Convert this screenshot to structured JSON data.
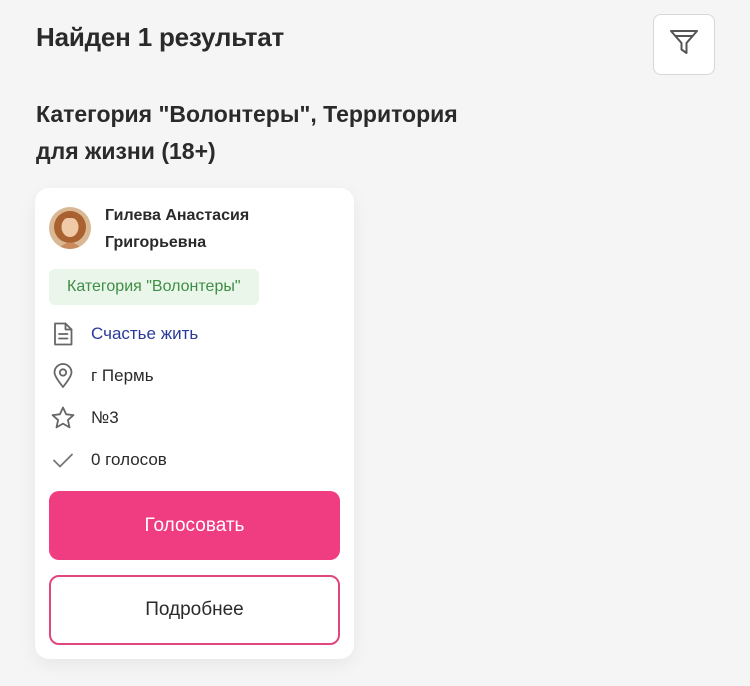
{
  "header": {
    "results_title": "Найден 1 результат",
    "filter_icon": "filter-funnel-icon"
  },
  "subtitle": "Категория \"Волонтеры\", Территория для жизни (18+)",
  "card": {
    "author_name": "Гилева Анастасия Григорьевна",
    "category_badge": "Категория \"Волонтеры\"",
    "project_link": "Счастье жить",
    "city": "г Пермь",
    "number": "№3",
    "votes": "0 голосов",
    "vote_button": "Голосовать",
    "details_button": "Подробнее",
    "icons": {
      "project": "document-icon",
      "city": "location-pin-icon",
      "number": "star-icon",
      "votes": "checkmark-icon"
    }
  },
  "colors": {
    "accent": "#f03c80",
    "badge_bg": "#eaf6ea",
    "badge_text": "#3e8e45",
    "link": "#2a3a9a",
    "background": "#f5f5f6"
  }
}
